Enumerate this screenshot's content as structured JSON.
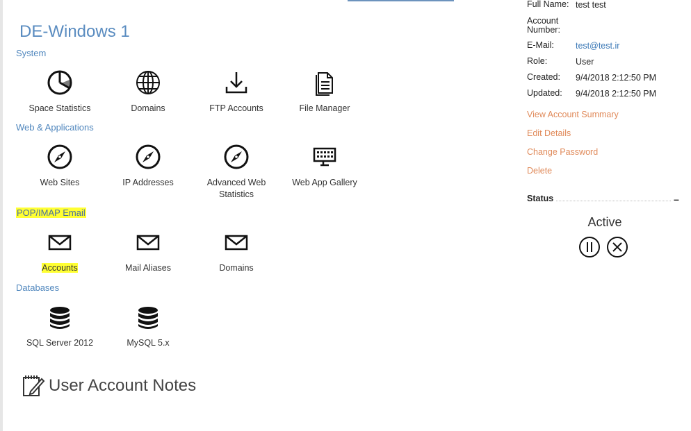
{
  "space": {
    "title": "DE-Windows 1"
  },
  "groups": [
    {
      "title": "System",
      "items": [
        {
          "label": "Space Statistics",
          "icon": "pie-chart-icon"
        },
        {
          "label": "Domains",
          "icon": "globe-icon"
        },
        {
          "label": "FTP Accounts",
          "icon": "download-icon"
        },
        {
          "label": "File Manager",
          "icon": "document-icon"
        }
      ]
    },
    {
      "title": "Web & Applications",
      "items": [
        {
          "label": "Web Sites",
          "icon": "compass-icon"
        },
        {
          "label": "IP Addresses",
          "icon": "compass-icon"
        },
        {
          "label": "Advanced Web Statistics",
          "icon": "compass-icon"
        },
        {
          "label": "Web App Gallery",
          "icon": "keyboard-monitor-icon"
        }
      ]
    },
    {
      "title": "POP/IMAP Email",
      "items": [
        {
          "label": "Accounts",
          "icon": "envelope-icon"
        },
        {
          "label": "Mail Aliases",
          "icon": "envelope-icon"
        },
        {
          "label": "Domains",
          "icon": "envelope-icon"
        }
      ]
    },
    {
      "title": "Databases",
      "items": [
        {
          "label": "SQL Server 2012",
          "icon": "database-icon"
        },
        {
          "label": "MySQL 5.x",
          "icon": "database-icon"
        }
      ]
    }
  ],
  "notes": {
    "title": "User Account Notes",
    "icon": "edit-note-icon"
  },
  "account": {
    "full_name_label": "Full Name:",
    "full_name": "test test",
    "account_number_label": "Account Number:",
    "account_number": "",
    "email_label": "E-Mail:",
    "email": "test@test.ir",
    "role_label": "Role:",
    "role": "User",
    "created_label": "Created:",
    "created": "9/4/2018 2:12:50 PM",
    "updated_label": "Updated:",
    "updated": "9/4/2018 2:12:50 PM"
  },
  "actions": {
    "view_summary": "View Account Summary",
    "edit_details": "Edit Details",
    "change_password": "Change Password",
    "delete": "Delete"
  },
  "status": {
    "title": "Status",
    "collapse": "–",
    "value": "Active",
    "pause_icon": "pause-circle-icon",
    "cancel_icon": "cancel-circle-icon"
  },
  "colors": {
    "title_blue": "#5a8cc0",
    "group_blue": "#4f86bd",
    "link_orange": "#e08a5a",
    "highlight": "#ffff33"
  }
}
